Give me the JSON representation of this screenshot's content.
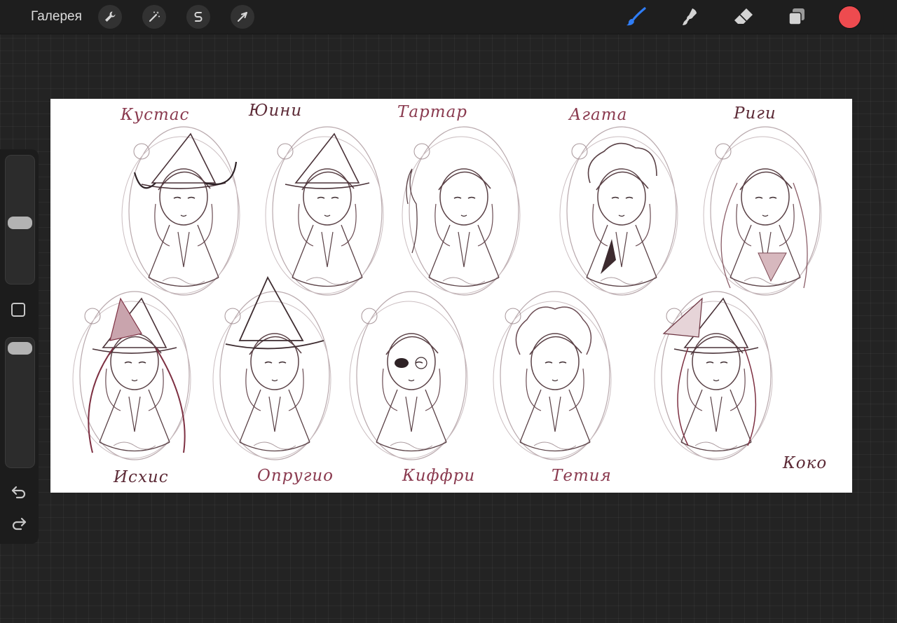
{
  "app": {
    "gallery_label": "Галерея",
    "left_tools": [
      "wrench-icon",
      "magic-wand-icon",
      "selection-s-icon",
      "transform-arrow-icon"
    ],
    "right_tools": [
      "brush-icon",
      "smudge-icon",
      "eraser-icon",
      "layers-icon"
    ],
    "active_tool": "brush",
    "current_color": "#ee4b4f",
    "accent_color": "#2f7df6"
  },
  "sidebar": {
    "brush_size_level": 0.45,
    "opacity_level": 0.92
  },
  "canvas": {
    "background": "#ffffff",
    "sketch_line_color": "#7d4a55",
    "names_row1": [
      "Кустас",
      "Юини",
      "Тартар",
      "Агата",
      "Риги"
    ],
    "names_row2": [
      "Исхис",
      "Опругио",
      "Киффри",
      "Тетия",
      "Коко"
    ]
  }
}
